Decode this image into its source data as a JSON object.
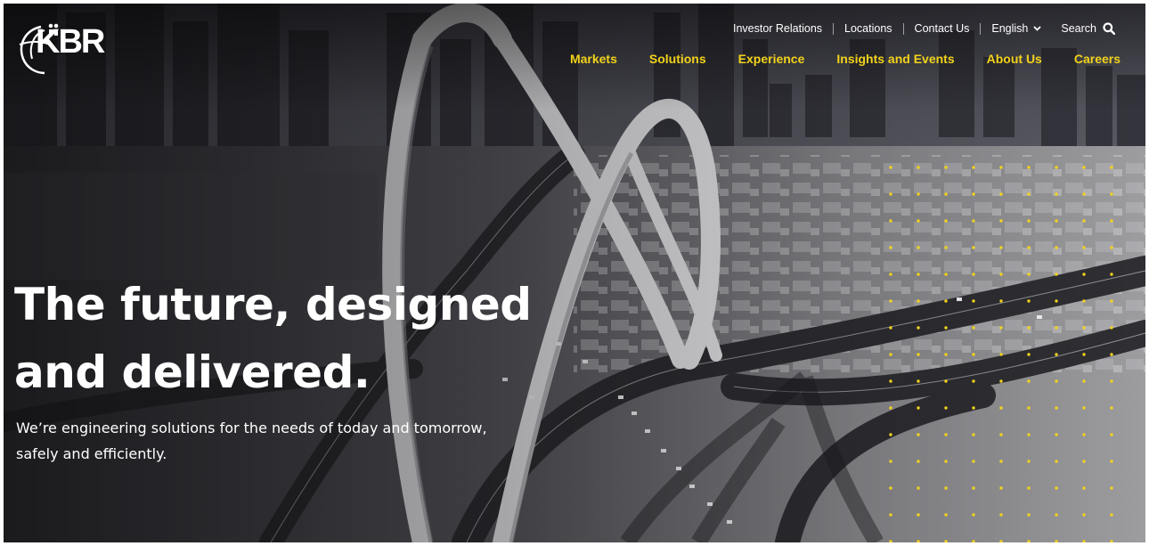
{
  "brand": {
    "logo_text": "KBR"
  },
  "utility_nav": {
    "items": [
      "Investor Relations",
      "Locations",
      "Contact Us"
    ],
    "language": "English",
    "search_label": "Search"
  },
  "main_nav": {
    "items": [
      "Markets",
      "Solutions",
      "Experience",
      "Insights and Events",
      "About Us",
      "Careers"
    ]
  },
  "hero": {
    "headline_line1": "The future, designed",
    "headline_line2": "and delivered.",
    "subhead_line1": "We’re engineering solutions for the needs of today and tomorrow,",
    "subhead_line2": "safely and efficiently."
  },
  "colors": {
    "accent_yellow": "#f2d21b",
    "text_white": "#ffffff"
  },
  "icons": {
    "search": "magnifier-icon",
    "language_dropdown": "chevron-down-icon",
    "logo_mark": "globe-figures-icon"
  }
}
